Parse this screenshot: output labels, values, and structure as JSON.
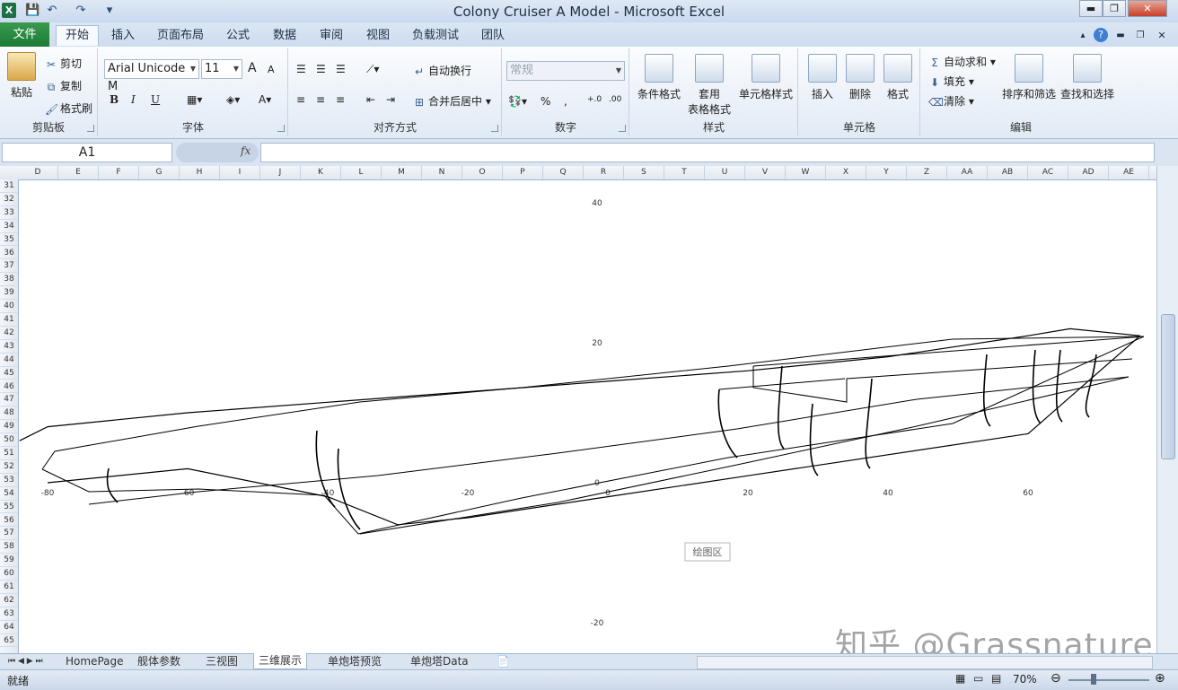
{
  "window": {
    "title": "Colony Cruiser A Model - Microsoft Excel",
    "min": "▬",
    "max": "❐",
    "close": "✕"
  },
  "ribbon_tabs": [
    "文件",
    "开始",
    "插入",
    "页面布局",
    "公式",
    "数据",
    "审阅",
    "视图",
    "负载测试",
    "团队"
  ],
  "clipboard": {
    "paste": "粘贴",
    "cut": "剪切",
    "copy": "复制",
    "format_painter": "格式刷",
    "label": "剪贴板"
  },
  "font": {
    "name": "Arial Unicode M",
    "size": "11",
    "label": "字体",
    "grow": "A",
    "shrink": "A",
    "bold": "B",
    "italic": "I",
    "underline": "U"
  },
  "alignment": {
    "wrap": "自动换行",
    "merge": "合并后居中",
    "label": "对齐方式"
  },
  "number": {
    "format": "常规",
    "percent": "%",
    "comma": ",",
    "inc": "+.0",
    "dec": ".00",
    "label": "数字"
  },
  "styles": {
    "conditional": "条件格式",
    "table_l1": "套用",
    "table_l2": "表格格式",
    "cell_styles": "单元格样式",
    "label": "样式"
  },
  "cells": {
    "insert": "插入",
    "delete": "删除",
    "format": "格式",
    "label": "单元格"
  },
  "editing": {
    "autosum": "自动求和",
    "fill": "填充",
    "clear": "清除",
    "sort": "排序和筛选",
    "find": "查找和选择",
    "label": "编辑"
  },
  "formula_bar": {
    "name_box": "A1",
    "fx": "fx",
    "value": ""
  },
  "columns": [
    "D",
    "E",
    "F",
    "G",
    "H",
    "I",
    "J",
    "K",
    "L",
    "M",
    "N",
    "O",
    "P",
    "Q",
    "R",
    "S",
    "T",
    "U",
    "V",
    "W",
    "X",
    "Y",
    "Z",
    "AA",
    "AB",
    "AC",
    "AD",
    "AE"
  ],
  "rows": [
    "31",
    "32",
    "33",
    "34",
    "35",
    "36",
    "37",
    "38",
    "39",
    "40",
    "41",
    "42",
    "43",
    "44",
    "45",
    "46",
    "47",
    "48",
    "49",
    "50",
    "51",
    "52",
    "53",
    "54",
    "55",
    "56",
    "57",
    "58",
    "59",
    "60",
    "61",
    "62",
    "63",
    "64",
    "65"
  ],
  "chart_data": {
    "type": "line",
    "plot_area_label": "绘图区",
    "x_ticks": [
      "-80",
      "-60",
      "-40",
      "-20",
      "0",
      "20",
      "40",
      "60"
    ],
    "y_ticks": [
      "40",
      "20",
      "0",
      "-20"
    ],
    "series": [
      {
        "values_hint": "hull wireframe: deck edge",
        "points": [
          [
            -84,
            6
          ],
          [
            -80,
            8
          ],
          [
            -60,
            10
          ],
          [
            -40,
            11.5
          ],
          [
            -20,
            13
          ],
          [
            0,
            14.5
          ],
          [
            20,
            16
          ],
          [
            40,
            18
          ],
          [
            60,
            21
          ],
          [
            66,
            22
          ],
          [
            76,
            21
          ]
        ]
      },
      {
        "values_hint": "hull wireframe: keel",
        "points": [
          [
            -80,
            0
          ],
          [
            -60,
            2
          ],
          [
            -40,
            -2
          ],
          [
            -30,
            -6
          ],
          [
            -20,
            -5
          ],
          [
            0,
            -2
          ],
          [
            20,
            1
          ],
          [
            40,
            4
          ],
          [
            60,
            7
          ],
          [
            76,
            21
          ]
        ]
      }
    ]
  },
  "sheets": [
    "HomePage",
    "舰体参数",
    "三视图",
    "三维展示",
    "单炮塔预览",
    "单炮塔Data"
  ],
  "active_sheet": "三维展示",
  "status": {
    "ready": "就绪",
    "zoom": "70%"
  },
  "watermark": "知乎 @Grassnature"
}
